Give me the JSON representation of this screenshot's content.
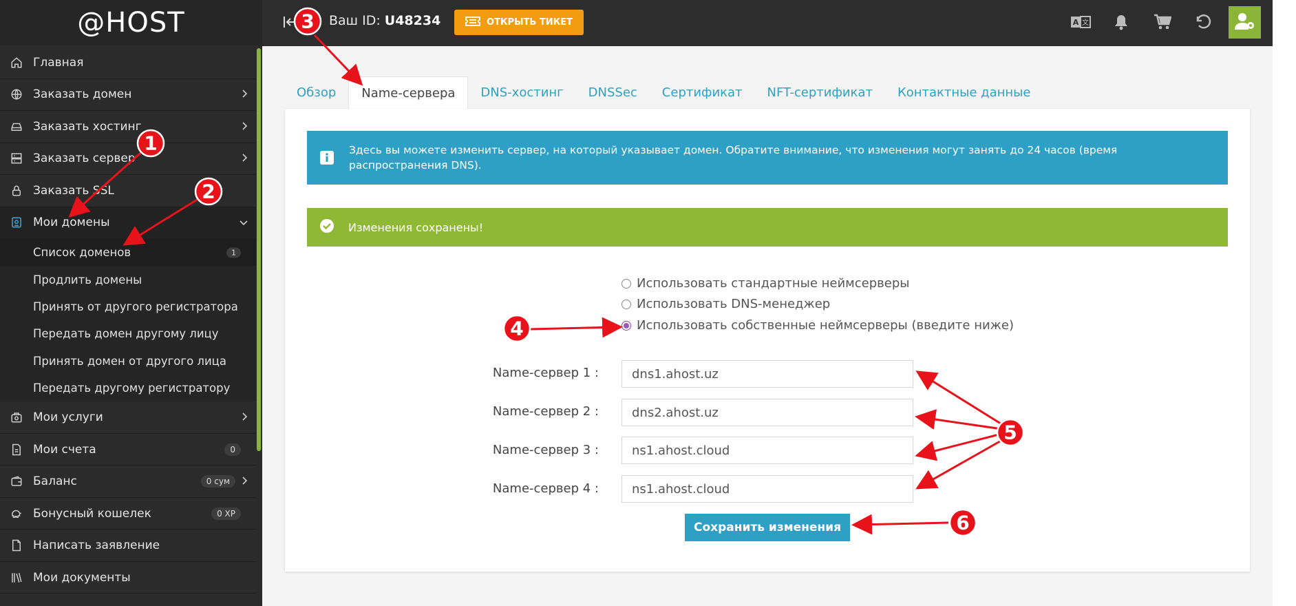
{
  "app": {
    "logo": "@HOST"
  },
  "sidebar": {
    "items_top": [
      {
        "label": "Главная",
        "icon": "home-icon"
      },
      {
        "label": "Заказать домен",
        "icon": "globe-icon"
      },
      {
        "label": "Заказать хостинг",
        "icon": "hard-drive-icon"
      },
      {
        "label": "Заказать сервер",
        "icon": "server-icon"
      },
      {
        "label": "Заказать SSL",
        "icon": "lock-icon"
      },
      {
        "label": "Мои домены",
        "icon": "domain-book-icon"
      }
    ],
    "sub_items": [
      {
        "label": "Список доменов",
        "badge": "1"
      },
      {
        "label": "Продлить домены"
      },
      {
        "label": "Принять от другого регистратора"
      },
      {
        "label": "Передать домен другому лицу"
      },
      {
        "label": "Принять домен от другого лица"
      },
      {
        "label": "Передать другому регистратору"
      }
    ],
    "items_bottom": [
      {
        "label": "Мои услуги",
        "icon": "services-icon"
      },
      {
        "label": "Мои счета",
        "icon": "invoice-icon",
        "badge": "0"
      },
      {
        "label": "Баланс",
        "icon": "wallet-icon",
        "badge": "0 сум"
      },
      {
        "label": "Бонусный кошелек",
        "icon": "piggy-bank-icon",
        "badge": "0 ХР"
      },
      {
        "label": "Написать заявление",
        "icon": "document-icon"
      },
      {
        "label": "Мои документы",
        "icon": "books-icon"
      }
    ]
  },
  "topbar": {
    "user_id_label": "Ваш ID: ",
    "user_id": "U48234",
    "ticket_label": "ОТКРЫТЬ ТИКЕТ"
  },
  "tabs": [
    "Обзор",
    "Name-сервера",
    "DNS-хостинг",
    "DNSSec",
    "Сертификат",
    "NFT-сертификат",
    "Контактные данные"
  ],
  "info": {
    "text": "Здесь вы можете изменить сервер, на который указывает домен. Обратите внимание, что изменения могут занять до 24 часов (время распространения DNS)."
  },
  "success": {
    "text": "Изменения сохранены!"
  },
  "radios": [
    {
      "label": "Использовать стандартные неймсерверы",
      "checked": false
    },
    {
      "label": "Использовать DNS-менеджер",
      "checked": false
    },
    {
      "label": "Использовать собственные неймсерверы (введите ниже)",
      "checked": true
    }
  ],
  "nameservers": [
    {
      "label": "Name-сервер 1 :",
      "value": "dns1.ahost.uz"
    },
    {
      "label": "Name-сервер 2 :",
      "value": "dns2.ahost.uz"
    },
    {
      "label": "Name-сервер 3 :",
      "value": "ns1.ahost.cloud"
    },
    {
      "label": "Name-сервер 4 :",
      "value": "ns1.ahost.cloud"
    }
  ],
  "save_label": "Сохранить изменения",
  "annotations": [
    "1",
    "2",
    "3",
    "4",
    "5",
    "6"
  ],
  "colors": {
    "accent_green": "#8bb536",
    "accent_blue": "#2ea0c6",
    "ticket_orange": "#f39c12",
    "annotation_red": "#e8121b"
  }
}
